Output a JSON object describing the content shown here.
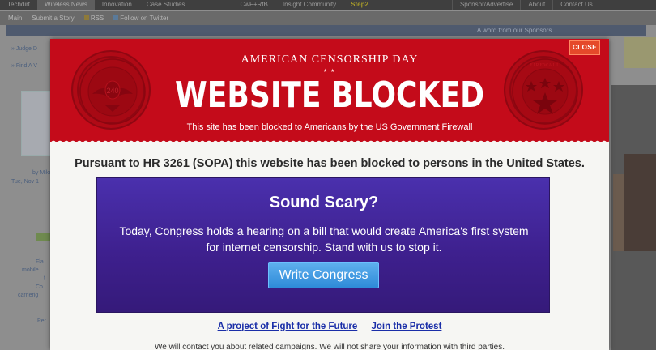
{
  "background_site": {
    "top_nav": [
      "Techdirt",
      "Wireless News",
      "Innovation",
      "Case Studies",
      "CwF+RtB",
      "Insight Community",
      "Step2",
      "Sponsor/Advertise",
      "About",
      "Contact Us"
    ],
    "sub_nav": [
      "Main",
      "Submit a Story",
      "RSS",
      "Follow on Twitter"
    ],
    "sponsor_text": "A word from our Sponsors...",
    "left_fragments": [
      "» Judge D",
      "» Find A V",
      "by Mike",
      "Tue, Nov 1",
      "Fla",
      "mobile",
      "t",
      "Co",
      "carrierig",
      "Per"
    ]
  },
  "modal": {
    "close_label": "CLOSE",
    "event_title": "AMERICAN CENSORSHIP DAY",
    "headline": "WEBSITE BLOCKED",
    "subtitle": "This site has been blocked to Americans by the US Government Firewall",
    "seal_left_text": "240",
    "seal_right_text": "FIREWALL",
    "pursuant": "Pursuant to HR 3261 (SOPA) this website has been blocked to persons in the United States.",
    "callout": {
      "heading": "Sound Scary?",
      "body_line1": "Today, Congress holds a hearing on a bill that would create America's first system",
      "body_line2": "for internet censorship. Stand with us to stop it.",
      "button_label": "Write Congress"
    },
    "links": {
      "project": "A project of Fight for the Future",
      "join": "Join the Protest"
    },
    "footnote": "We will contact you about related campaigns. We will not share your information with third parties."
  },
  "colors": {
    "banner_red": "#c40b1a",
    "callout_purple": "#3d1f8c",
    "button_blue": "#2e8ad8",
    "close_orange": "#e5492a"
  }
}
